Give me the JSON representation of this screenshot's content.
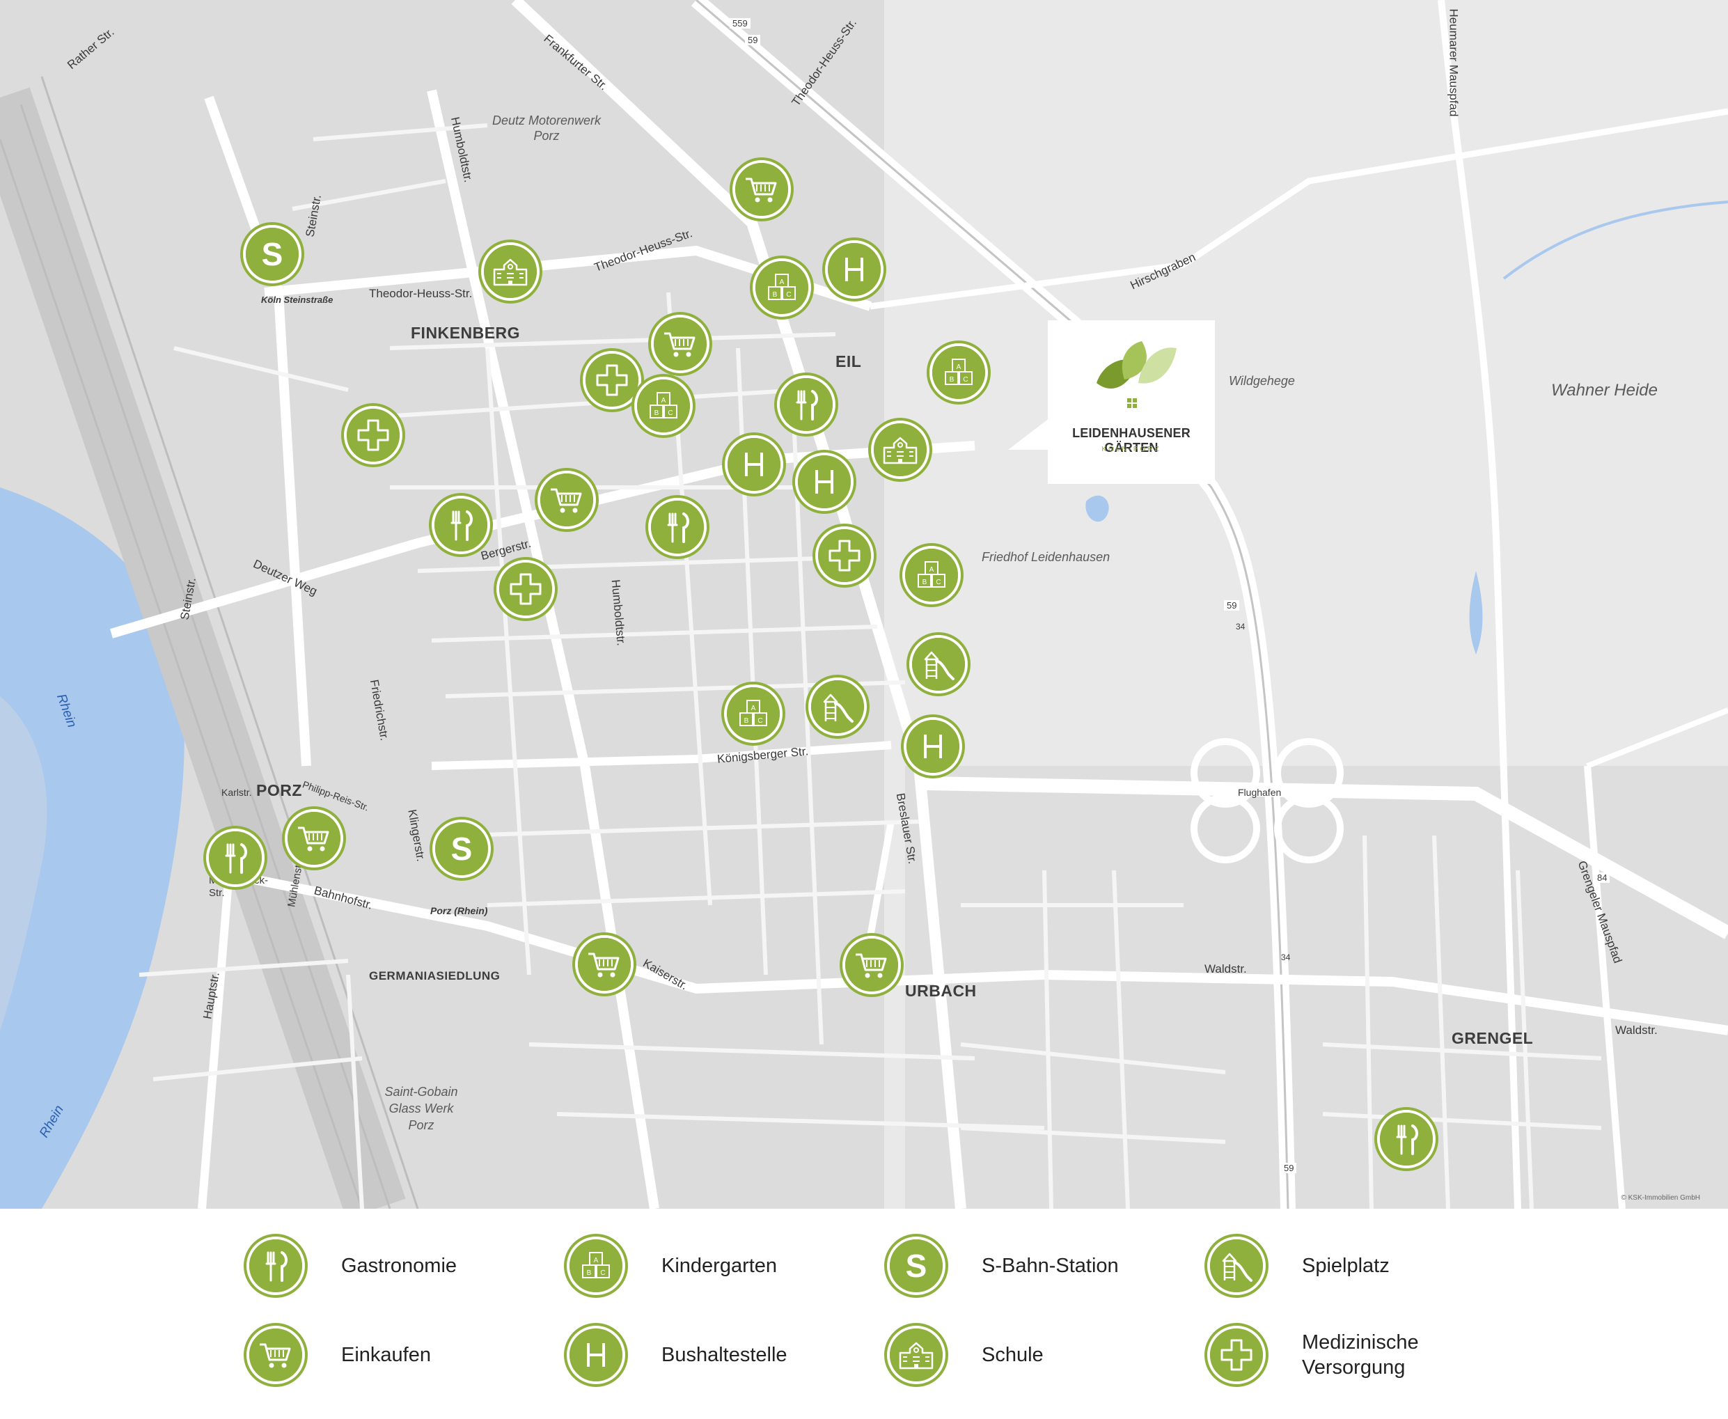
{
  "map": {
    "colors": {
      "land": "#dcdcdc",
      "road": "#ffffff",
      "water": "#a9c8ee",
      "poi": "#8fb03c",
      "east": "#e9e9e9"
    },
    "districts": [
      "FINKENBERG",
      "EIL",
      "PORZ",
      "GERMANIASIEDLUNG",
      "URBACH",
      "GRENGEL"
    ],
    "streets": [
      "Rather Str.",
      "Frankfurter Str.",
      "Theodor-Heuss-Str.",
      "Theodor-Heuss-Str.",
      "Theodor-Heuss-Str.",
      "Humboldtstr.",
      "Humboldtstr.",
      "Steinstr.",
      "Steinstr.",
      "Deutzer Weg",
      "Bergerstr.",
      "Friedrichstr.",
      "Königsberger Str.",
      "Breslauer Str.",
      "Kaiserstr.",
      "Bahnhofstr.",
      "Karlstr.",
      "Philipp-Reis-Str.",
      "Klingerstr.",
      "Ernst-Mühlendyck-Str.",
      "Mühlenstr.",
      "Hauptstr.",
      "Waldstr.",
      "Waldstr.",
      "Hirschgraben",
      "Heumarer Mauspfad",
      "Grengeler Mauspfad",
      "Flughafen"
    ],
    "places": [
      "Deutz Motorenwerk Porz",
      "Wildgehege",
      "Wahner Heide",
      "Friedhof Leidenhausen",
      "Saint-Gobain Glass Werk Porz"
    ],
    "stations": [
      "Köln Steinstraße",
      "Porz (Rhein)"
    ],
    "rivers": [
      "Rhein",
      "Rhein"
    ],
    "highways": [
      "559",
      "59",
      "59",
      "34",
      "34",
      "59",
      "84"
    ],
    "logo": {
      "name": "LEIDENHAUSENER GÄRTEN",
      "sub": "KÖLN-PORZ"
    },
    "copyright": "© KSK-Immobilien GmbH",
    "pois": [
      {
        "type": "einkaufen"
      },
      {
        "type": "sbahn"
      },
      {
        "type": "schule"
      },
      {
        "type": "kindergarten"
      },
      {
        "type": "bus"
      },
      {
        "type": "einkaufen"
      },
      {
        "type": "medizin"
      },
      {
        "type": "kindergarten"
      },
      {
        "type": "medizin"
      },
      {
        "type": "gastronomie"
      },
      {
        "type": "kindergarten"
      },
      {
        "type": "bus"
      },
      {
        "type": "bus"
      },
      {
        "type": "schule"
      },
      {
        "type": "gastronomie"
      },
      {
        "type": "einkaufen"
      },
      {
        "type": "gastronomie"
      },
      {
        "type": "medizin"
      },
      {
        "type": "medizin"
      },
      {
        "type": "kindergarten"
      },
      {
        "type": "spielplatz"
      },
      {
        "type": "kindergarten"
      },
      {
        "type": "spielplatz"
      },
      {
        "type": "bus"
      },
      {
        "type": "gastronomie"
      },
      {
        "type": "einkaufen"
      },
      {
        "type": "sbahn"
      },
      {
        "type": "einkaufen"
      },
      {
        "type": "einkaufen"
      },
      {
        "type": "gastronomie"
      }
    ]
  },
  "legend": {
    "items": [
      {
        "type": "gastronomie",
        "label": "Gastronomie"
      },
      {
        "type": "kindergarten",
        "label": "Kindergarten"
      },
      {
        "type": "sbahn",
        "label": "S-Bahn-Station"
      },
      {
        "type": "spielplatz",
        "label": "Spielplatz"
      },
      {
        "type": "einkaufen",
        "label": "Einkaufen"
      },
      {
        "type": "bus",
        "label": "Bushaltestelle"
      },
      {
        "type": "schule",
        "label": "Schule"
      },
      {
        "type": "medizin",
        "label": "Medizinische Versorgung"
      }
    ]
  }
}
